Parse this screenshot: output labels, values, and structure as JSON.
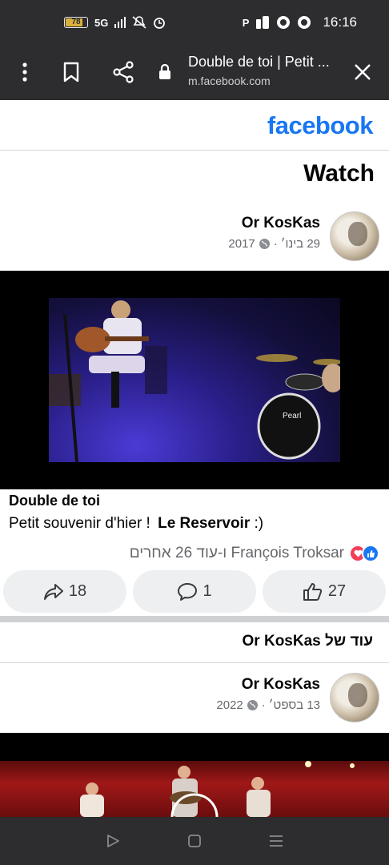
{
  "status_bar": {
    "battery": "78",
    "network": "5G",
    "time": "16:16",
    "right_glyph": "P"
  },
  "browser": {
    "title": "Double de toi | Petit ...",
    "url": "m.facebook.com"
  },
  "app": {
    "logo": "facebook",
    "section": "Watch"
  },
  "post1": {
    "author": "Or KosKas",
    "date": "29 בינו׳",
    "separator": "·",
    "year": "2017",
    "title": "Double de toi",
    "text": "Petit souvenir d'hier !",
    "mention": "Le Reservoir",
    "text_end": " :)",
    "reactions_text": "François Troksar ו-עוד 26 אחרים",
    "share_count": "18",
    "comment_count": "1",
    "like_count": "27"
  },
  "more_from": "עוד של Or KosKas",
  "post2": {
    "author": "Or KosKas",
    "date": "13 בספט׳",
    "separator": "·",
    "year": "2022"
  },
  "colors": {
    "brand": "#1877f2",
    "bar": "#2d2d2f",
    "love": "#f33e58"
  }
}
